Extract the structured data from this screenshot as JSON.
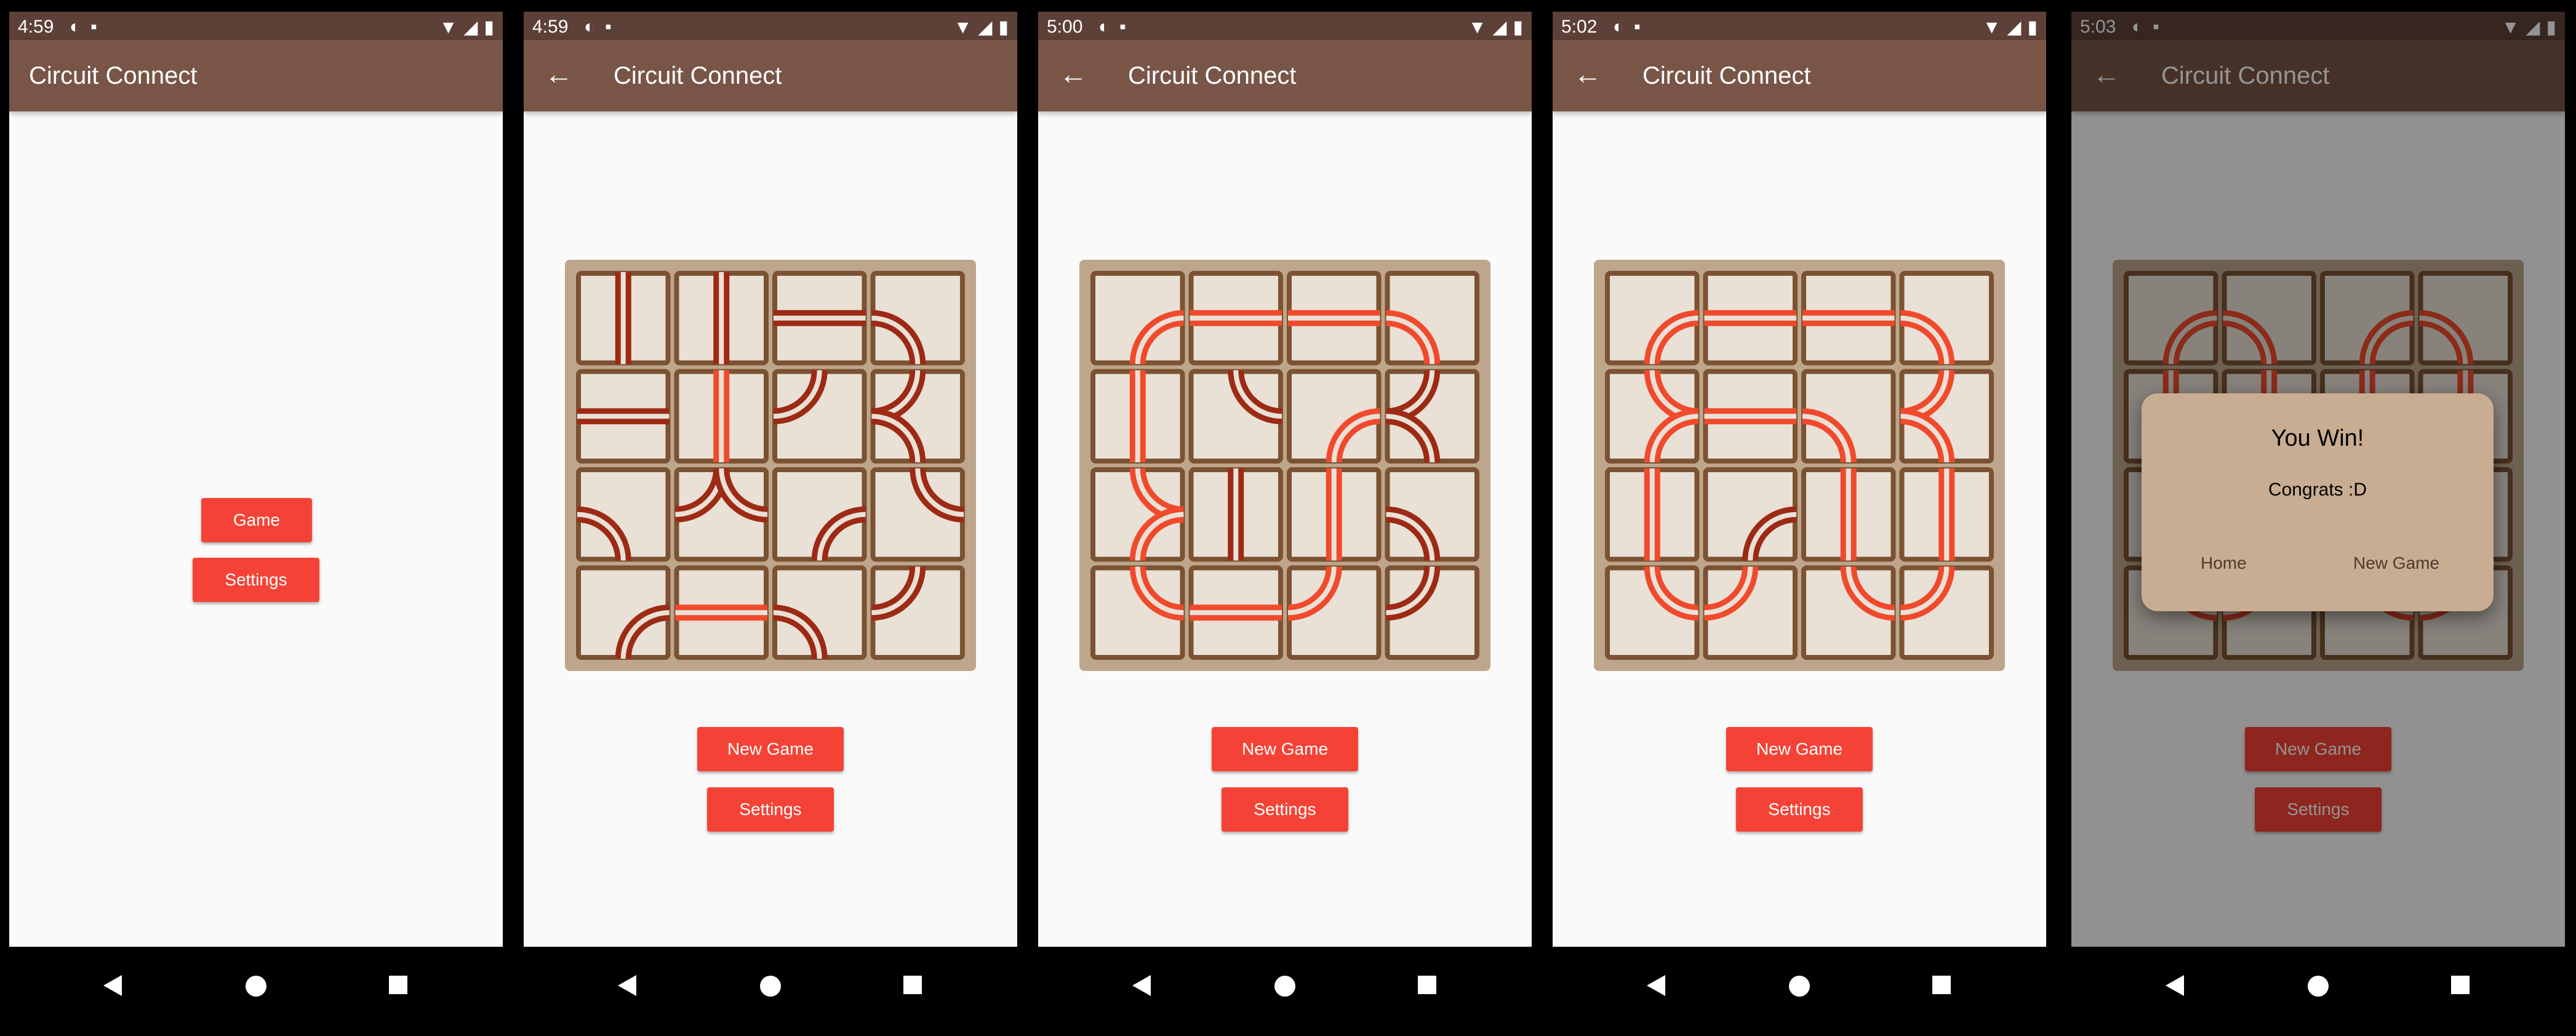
{
  "screens": [
    {
      "time": "4:59",
      "title": "Circuit Connect",
      "buttons": [
        "Game",
        "Settings"
      ]
    },
    {
      "time": "4:59",
      "title": "Circuit Connect",
      "buttons": [
        "New Game",
        "Settings"
      ]
    },
    {
      "time": "5:00",
      "title": "Circuit Connect",
      "buttons": [
        "New Game",
        "Settings"
      ]
    },
    {
      "time": "5:02",
      "title": "Circuit Connect",
      "buttons": [
        "New Game",
        "Settings"
      ]
    },
    {
      "time": "5:03",
      "title": "Circuit Connect",
      "buttons": [
        "New Game",
        "Settings"
      ]
    }
  ],
  "dialog": {
    "title": "You Win!",
    "message": "Congrats :D",
    "home": "Home",
    "new_game": "New Game"
  },
  "colors": {
    "status_bar": "#5d4037",
    "app_bar": "#795548",
    "accent": "#f44336",
    "board": "#bea68c",
    "tile": "#e9e0d6",
    "tile_border": "#7b5232",
    "wire_off": "#9c2a14",
    "wire_on": "#f04a2c"
  },
  "icons": [
    "back-arrow-icon",
    "wifi-icon",
    "signal-icon",
    "battery-icon",
    "sd-card-icon",
    "notification-icon",
    "nav-back-icon",
    "nav-home-icon",
    "nav-recents-icon"
  ],
  "boards": [
    [
      [
        "v",
        "off"
      ],
      [
        "v",
        "off"
      ],
      [
        "h",
        "off"
      ],
      [
        "cWS",
        "off"
      ],
      [
        "h",
        "off"
      ],
      [
        "v",
        "on"
      ],
      [
        "cWN",
        "off"
      ],
      [
        "dW",
        "off"
      ],
      [
        "cWS",
        "off"
      ],
      [
        "dN",
        "off"
      ],
      [
        "cES",
        "off"
      ],
      [
        "cEN",
        "off"
      ],
      [
        "cES",
        "off"
      ],
      [
        "h",
        "on"
      ],
      [
        "cWS",
        "off"
      ],
      [
        "cWN",
        "off"
      ]
    ],
    [
      [
        "cES",
        "on"
      ],
      [
        "h",
        "on"
      ],
      [
        "h",
        "on"
      ],
      [
        "cWS",
        "on"
      ],
      [
        "v",
        "on"
      ],
      [
        "cEN",
        "off"
      ],
      [
        "cES",
        "on"
      ],
      [
        "dW",
        "off"
      ],
      [
        "dE",
        "on"
      ],
      [
        "v",
        "off"
      ],
      [
        "v",
        "on"
      ],
      [
        "cWS",
        "off"
      ],
      [
        "cEN",
        "on"
      ],
      [
        "h",
        "on"
      ],
      [
        "cWN",
        "on"
      ],
      [
        "cWN",
        "off"
      ]
    ],
    [
      [
        "cES",
        "on"
      ],
      [
        "h",
        "on"
      ],
      [
        "h",
        "on"
      ],
      [
        "cWS",
        "on"
      ],
      [
        "dE",
        "on"
      ],
      [
        "h",
        "on"
      ],
      [
        "cWS",
        "on"
      ],
      [
        "dW",
        "on"
      ],
      [
        "v",
        "on"
      ],
      [
        "cES",
        "off"
      ],
      [
        "v",
        "on"
      ],
      [
        "v",
        "on"
      ],
      [
        "cEN",
        "on"
      ],
      [
        "cWN",
        "on"
      ],
      [
        "cEN",
        "on"
      ],
      [
        "cWN",
        "on"
      ]
    ],
    [
      [
        "cES",
        "on"
      ],
      [
        "cWS",
        "on"
      ],
      [
        "cES",
        "on"
      ],
      [
        "cWS",
        "on"
      ],
      [
        "v",
        "on"
      ],
      [
        "v",
        "on"
      ],
      [
        "v",
        "on"
      ],
      [
        "v",
        "on"
      ],
      [
        "v",
        "on"
      ],
      [
        "v",
        "on"
      ],
      [
        "v",
        "on"
      ],
      [
        "v",
        "on"
      ],
      [
        "cEN",
        "on"
      ],
      [
        "cWN",
        "on"
      ],
      [
        "cEN",
        "on"
      ],
      [
        "cWN",
        "on"
      ]
    ]
  ]
}
